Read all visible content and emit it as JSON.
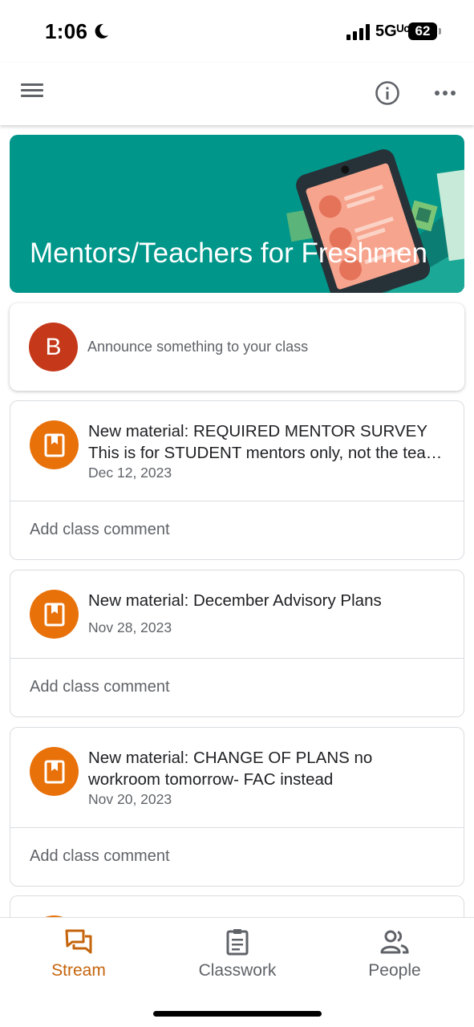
{
  "status_bar": {
    "time": "1:06",
    "network": "5Gᵁᶜ",
    "battery": "62"
  },
  "app_bar": {
    "menu_icon": "hamburger-menu-icon",
    "info_icon": "info-icon",
    "more_icon": "more-horizontal-icon"
  },
  "banner": {
    "title": "Mentors/Teachers for Freshmen",
    "color": "#00968a"
  },
  "announce": {
    "avatar_letter": "B",
    "avatar_color": "#c5391a",
    "placeholder": "Announce something to your class"
  },
  "posts": [
    {
      "title_line1": "New material: REQUIRED MENTOR SURVEY",
      "title_line2": "This is for STUDENT mentors only, not the teachers",
      "date": "Dec 12, 2023",
      "comment_label": "Add class comment"
    },
    {
      "title_line1": "New material: December Advisory Plans",
      "title_line2": "",
      "date": "Nov 28, 2023",
      "comment_label": "Add class comment"
    },
    {
      "title_line1": "New material: CHANGE OF PLANS no",
      "title_line2": "workroom tomorrow- FAC instead",
      "date": "Nov 20, 2023",
      "comment_label": "Add class comment"
    }
  ],
  "material_icon": "book-icon",
  "material_color": "#e8710a",
  "bottom_nav": {
    "items": [
      {
        "label": "Stream",
        "icon": "stream-icon",
        "active": true
      },
      {
        "label": "Classwork",
        "icon": "classwork-icon",
        "active": false
      },
      {
        "label": "People",
        "icon": "people-icon",
        "active": false
      }
    ],
    "active_color": "#c5640b"
  }
}
